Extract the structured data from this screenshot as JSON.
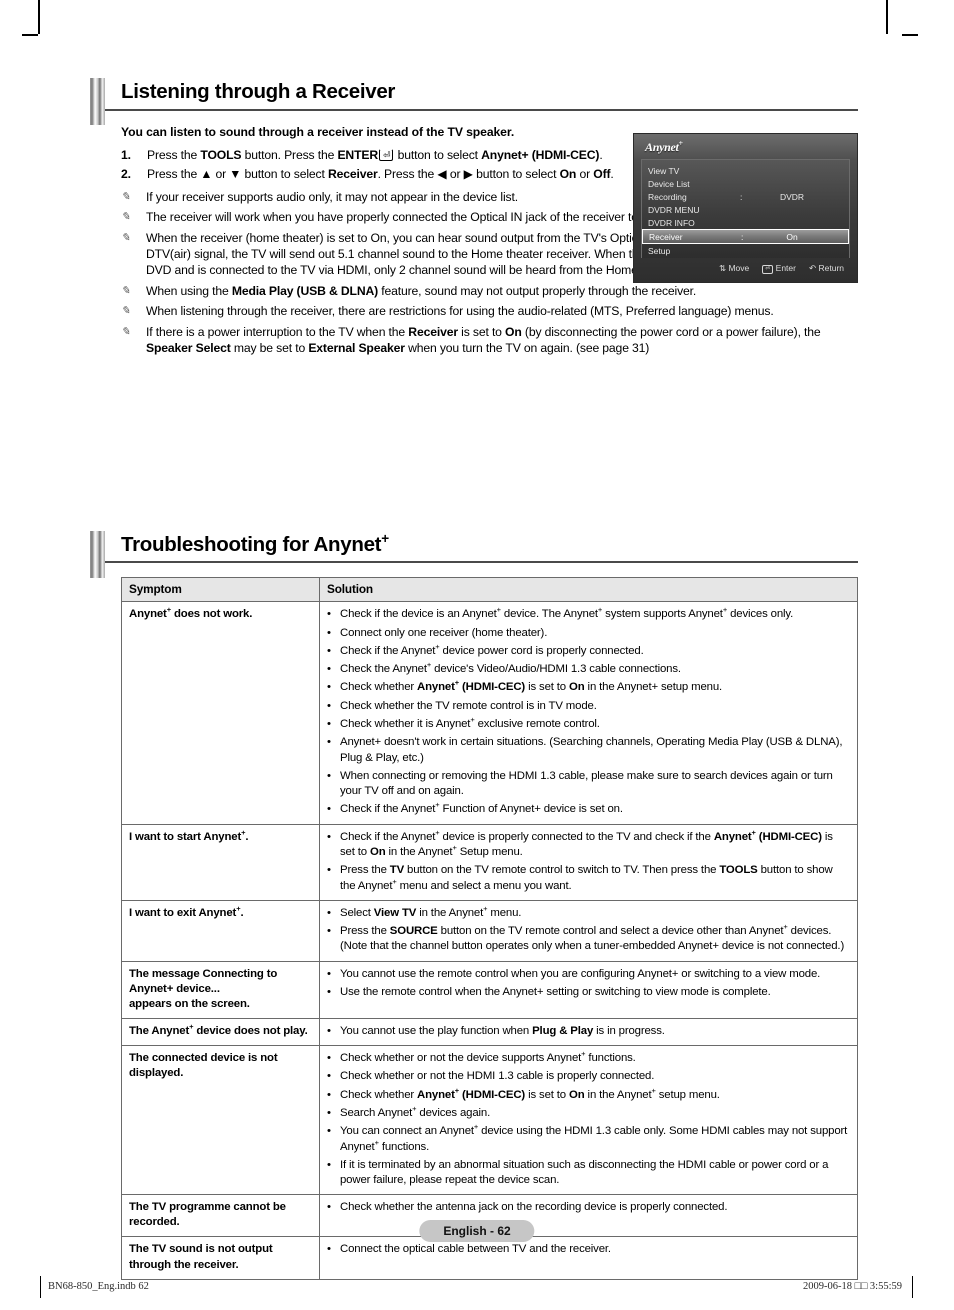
{
  "section1": {
    "title": "Listening through a Receiver",
    "intro": "You can listen to sound through a receiver instead of the TV speaker.",
    "steps": [
      {
        "num": "1.",
        "html": "Press the <b>TOOLS</b> button. Press the <b>ENTER</b><span class=\"enterkey\" data-name=\"enter-key-icon\">&#9166;</span> button to select <b>Anynet+ (HDMI-CEC)</b>."
      },
      {
        "num": "2.",
        "html": "Press the &#9650; or &#9660; button to select <b>Receiver</b>. Press the &#9664; or &#9654; button to select <b>On</b> or <b>Off</b>."
      }
    ],
    "notes": [
      {
        "html": "If your receiver supports audio only, it may not appear in the device list."
      },
      {
        "html": "The receiver will work when you have properly connected the Optical IN jack of the receiver to the Optical Out jack of the TV."
      },
      {
        "html": "When the receiver (home theater) is set to On, you can hear sound output from the TV's Optical jack. When the TV is displaying a DTV(air) signal, the TV will send out 5.1 channel sound to the Home theater receiver. When the source is a digital component such as a DVD and is connected to the TV via HDMI, only 2 channel sound will be heard from the Home Theater receiver."
      },
      {
        "html": "When using the <b>Media Play (USB &amp; DLNA)</b> feature, sound may not output properly through the receiver."
      },
      {
        "html": "When listening through the receiver, there are restrictions for using the audio-related (MTS, Preferred language) menus."
      },
      {
        "html": "If there is a power interruption to the TV when the <b>Receiver</b> is set to <b>On</b> (by disconnecting the power cord or a power failure), the <b>Speaker Select</b> may be set to <b>External Speaker</b> when you turn the TV on again. (see page 31)"
      }
    ],
    "note_icon": "note-pencil-icon"
  },
  "osd": {
    "logo": "Anynet",
    "logo_sup": "+",
    "rows": [
      {
        "label": "View TV",
        "colon": "",
        "value": ""
      },
      {
        "label": "Device List",
        "colon": "",
        "value": ""
      },
      {
        "label": "Recording",
        "colon": ":",
        "value": "DVDR"
      },
      {
        "label": "DVDR MENU",
        "colon": "",
        "value": ""
      },
      {
        "label": "DVDR INFO",
        "colon": "",
        "value": ""
      },
      {
        "label": "Receiver",
        "colon": ":",
        "value": "On",
        "highlighted": true
      },
      {
        "label": "Setup",
        "colon": "",
        "value": ""
      }
    ],
    "footer": [
      {
        "icon": "&#8645;",
        "label": "Move",
        "boxed": false
      },
      {
        "icon": "&#9166;",
        "label": "Enter",
        "boxed": true
      },
      {
        "icon": "&#8630;",
        "label": "Return",
        "boxed": false
      }
    ]
  },
  "section2": {
    "title": "Troubleshooting for Anynet",
    "title_sup": "+",
    "headers": {
      "symptom": "Symptom",
      "solution": "Solution"
    },
    "rows": [
      {
        "symptom": "Anynet<sup class=\"sup\">+</sup> does not work.",
        "solutions": [
          "Check if the device is an Anynet<sup class=\"sup\">+</sup> device. The Anynet<sup class=\"sup\">+</sup> system supports Anynet<sup class=\"sup\">+</sup> devices only.",
          "Connect only one receiver (home theater).",
          "Check if the Anynet<sup class=\"sup\">+</sup> device power cord is properly connected.",
          "Check the Anynet<sup class=\"sup\">+</sup> device's Video/Audio/HDMI 1.3 cable connections.",
          "Check whether <b>Anynet<sup class=\"sup\">+</sup> (HDMI-CEC)</b> is set to <b>On</b> in the Anynet+ setup menu.",
          "Check whether the TV remote control is in TV mode.",
          "Check whether it is Anynet<sup class=\"sup\">+</sup> exclusive remote control.",
          "Anynet+ doesn't work in certain situations. (Searching channels, Operating Media Play (USB &amp; DLNA), Plug &amp; Play, etc.)",
          "When connecting or removing the HDMI 1.3 cable, please make sure to search devices again or turn your TV off and on again.",
          "Check if the Anynet<sup class=\"sup\">+</sup> Function of Anynet+ device is set on."
        ]
      },
      {
        "symptom": "I want to start Anynet<sup class=\"sup\">+</sup>.",
        "solutions": [
          "Check if the Anynet<sup class=\"sup\">+</sup> device is properly connected to the TV and check if the <b>Anynet<sup class=\"sup\">+</sup> (HDMI-CEC)</b> is set to <b>On</b> in the Anynet<sup class=\"sup\">+</sup> Setup menu.",
          "Press the <b>TV</b> button on the TV remote control to switch to TV. Then press the <b>TOOLS</b> button to show the Anynet<sup class=\"sup\">+</sup> menu and select a menu you want."
        ]
      },
      {
        "symptom": "I want to exit Anynet<sup class=\"sup\">+</sup>.",
        "solutions": [
          "Select <b>View TV</b> in the Anynet<sup class=\"sup\">+</sup> menu.",
          "Press the <b>SOURCE</b> button on the TV remote control and select a device other than Anynet<sup class=\"sup\">+</sup> devices. (Note that the channel button operates only when a tuner-embedded Anynet+ device is not connected.)"
        ]
      },
      {
        "symptom": "The message Connecting to Anynet+ device...<br>appears on the screen.",
        "solutions": [
          "You cannot use the remote control when you are configuring Anynet+ or switching to a view mode.",
          "Use the remote control when the Anynet+ setting or switching to view mode is complete."
        ]
      },
      {
        "symptom": "The Anynet<sup class=\"sup\">+</sup> device does not play.",
        "solutions": [
          "You cannot use the play function when <b>Plug &amp; Play</b> is in progress."
        ]
      },
      {
        "symptom": "The connected device is not displayed.",
        "solutions": [
          "Check whether or not the device supports Anynet<sup class=\"sup\">+</sup> functions.",
          "Check whether or not the HDMI 1.3 cable is properly connected.",
          "Check whether <b>Anynet<sup class=\"sup\">+</sup> (HDMI-CEC)</b> is set to <b>On</b> in the Anynet<sup class=\"sup\">+</sup> setup menu.",
          "Search Anynet<sup class=\"sup\">+</sup> devices again.",
          "You can connect an Anynet<sup class=\"sup\">+</sup> device using the HDMI 1.3 cable only. Some HDMI cables may not support Anynet<sup class=\"sup\">+</sup> functions.",
          "If it is terminated by an abnormal situation such as disconnecting the HDMI cable or power cord or a power failure, please repeat the device scan."
        ]
      },
      {
        "symptom": "The TV programme cannot be recorded.",
        "solutions": [
          "Check whether the antenna jack on the recording device is properly connected."
        ]
      },
      {
        "symptom": "The TV sound is not output through the receiver.",
        "solutions": [
          "Connect the optical cable between TV and the receiver."
        ]
      }
    ]
  },
  "footer": {
    "page_label": "English - 62",
    "file_meta": "BN68-850_Eng.indb   62",
    "timestamp": "2009-06-18   □□ 3:55:59"
  }
}
